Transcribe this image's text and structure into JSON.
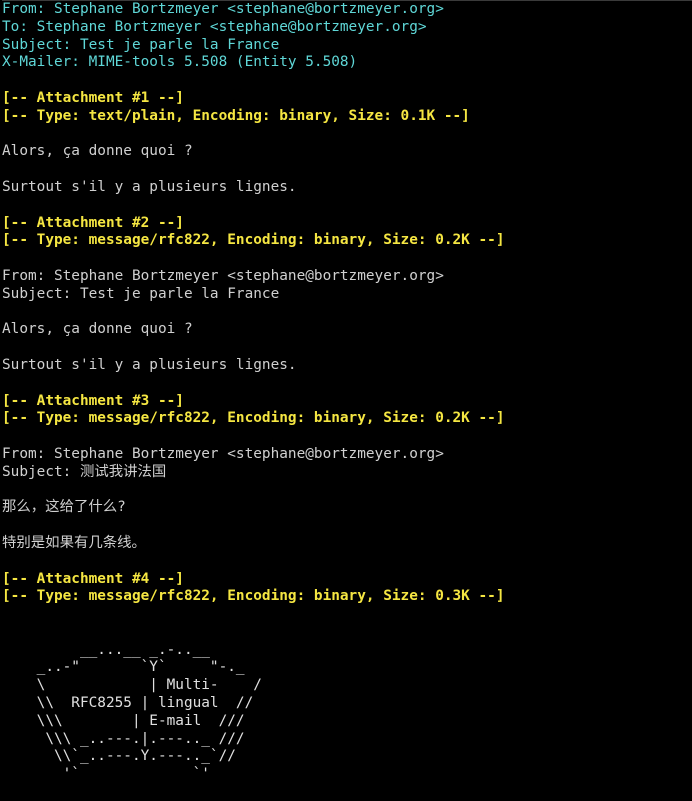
{
  "colors": {
    "background": "#000000",
    "header_text": "#5fd7d7",
    "body_text": "#d0d0d0",
    "attachment_marker": "#f5e642"
  },
  "headers": {
    "from": "From: Stephane Bortzmeyer <stephane@bortzmeyer.org>",
    "to": "To: Stephane Bortzmeyer <stephane@bortzmeyer.org>",
    "subject": "Subject: Test je parle la France",
    "xmailer": "X-Mailer: MIME-tools 5.508 (Entity 5.508)"
  },
  "attachments": [
    {
      "title": "[-- Attachment #1 --]",
      "type": "[-- Type: text/plain, Encoding: binary, Size: 0.1K --]",
      "lines": [
        "Alors, ça donne quoi ?",
        "Surtout s'il y a plusieurs lignes."
      ]
    },
    {
      "title": "[-- Attachment #2 --]",
      "type": "[-- Type: message/rfc822, Encoding: binary, Size: 0.2K --]",
      "from": "From: Stephane Bortzmeyer <stephane@bortzmeyer.org>",
      "subject": "Subject: Test je parle la France",
      "lines": [
        "Alors, ça donne quoi ?",
        "Surtout s'il y a plusieurs lignes."
      ]
    },
    {
      "title": "[-- Attachment #3 --]",
      "type": "[-- Type: message/rfc822, Encoding: binary, Size: 0.2K --]",
      "from": "From: Stephane Bortzmeyer <stephane@bortzmeyer.org>",
      "subject": "Subject: 测试我讲法国",
      "lines": [
        "那么，这给了什么?",
        "特别是如果有几条线。"
      ]
    },
    {
      "title": "[-- Attachment #4 --]",
      "type": "[-- Type: message/rfc822, Encoding: binary, Size: 0.3K --]"
    }
  ],
  "ascii_art": [
    "         __...__ _.-..__",
    "    _..-\"       `Y`     \"-._",
    "    \\            | Multi-    /",
    "    \\\\  RFC8255 | lingual  //",
    "    \\\\\\        | E-mail  ///",
    "     \\\\\\ _..---.|.---.._ ///",
    "      \\\\`_..---.Y.---.._`//",
    "       '`             `'"
  ]
}
